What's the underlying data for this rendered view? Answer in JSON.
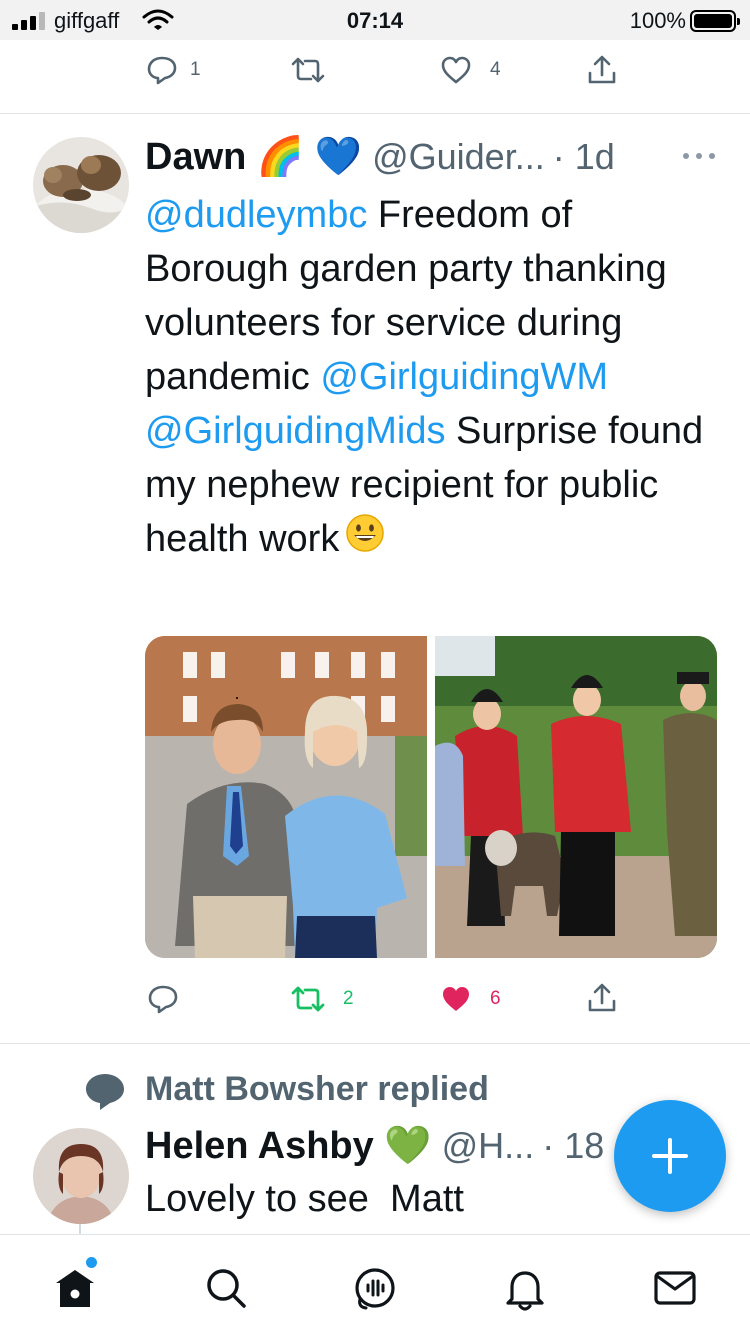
{
  "status_bar": {
    "carrier": "giffgaff",
    "time": "07:14",
    "battery": "100%"
  },
  "prev_tweet_actions": {
    "replies": "1",
    "retweets": "",
    "likes": "4"
  },
  "tweet": {
    "author_name": "Dawn 🌈 💙",
    "handle": "@Guider...",
    "time_ago": "· 1d",
    "text_parts": {
      "mention1": "@dudleymbc",
      "body1": " Freedom of Borough garden party thanking volunteers for service during pandemic ",
      "mention2": "@GirlguidingWM",
      "mention3": "@GirlguidingMids",
      "body2": " Surprise found my nephew recipient for public health work"
    },
    "actions": {
      "replies": "",
      "retweets": "2",
      "likes": "6"
    },
    "colors": {
      "retweet_active": "#17bf63",
      "like_active": "#e0245e"
    }
  },
  "reply": {
    "context": "Matt Bowsher replied",
    "author_name": "Helen Ashby 💚",
    "handle": "@H...",
    "time_ago": "· 18",
    "text": "Lovely to see  Matt"
  },
  "icons": {
    "fab": "compose-plus-icon",
    "nav": [
      "home-icon",
      "search-icon",
      "spaces-icon",
      "notifications-icon",
      "messages-icon"
    ]
  },
  "colors": {
    "accent": "#1d9bf0",
    "text_primary": "#0f1419",
    "text_secondary": "#536471"
  }
}
